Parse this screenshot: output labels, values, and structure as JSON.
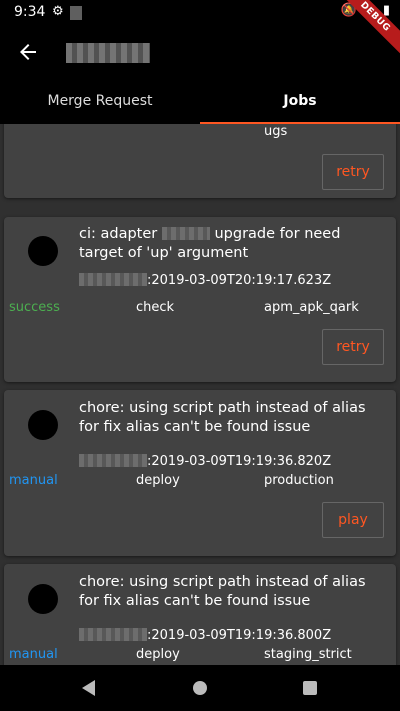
{
  "status_bar": {
    "time": "9:34"
  },
  "debug_banner": "DEBUG",
  "tabs": [
    {
      "label": "Merge Request"
    },
    {
      "label": "Jobs"
    }
  ],
  "jobs": [
    {
      "tail": "ugs",
      "action": "retry"
    },
    {
      "status": "success",
      "title_pre": "ci: adapter",
      "title_post": "upgrade for need target of 'up' argument",
      "timestamp": ":2019-03-09T20:19:17.623Z",
      "stage": "check",
      "name": "apm_apk_qark",
      "action": "retry",
      "status_color": "#4caf50"
    },
    {
      "status": "manual",
      "title": "chore: using script path instead of alias for fix alias can't be found issue",
      "timestamp": ":2019-03-09T19:19:36.820Z",
      "stage": "deploy",
      "name": "production",
      "action": "play",
      "status_color": "#2196f3"
    },
    {
      "status": "manual",
      "title": "chore: using script path instead of alias for fix alias can't be found issue",
      "timestamp": ":2019-03-09T19:19:36.800Z",
      "stage": "deploy",
      "name": "staging_strict",
      "status_color": "#2196f3"
    }
  ],
  "colors": {
    "accent": "#ff5722",
    "card": "#424242",
    "background": "#303030"
  }
}
